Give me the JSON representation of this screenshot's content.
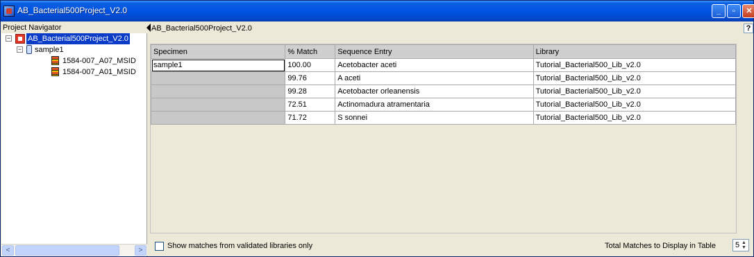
{
  "window": {
    "title": "AB_Bacterial500Project_V2.0",
    "buttons": [
      "minimize",
      "maximize",
      "close"
    ]
  },
  "navigator": {
    "title": "Project Navigator",
    "project": "AB_Bacterial500Project_V2.0",
    "sample": "sample1",
    "items": [
      "1584-007_A07_MSID",
      "1584-007_A01_MSID"
    ]
  },
  "main": {
    "title": "AB_Bacterial500Project_V2.0",
    "help": "?",
    "columns": [
      "Specimen",
      "% Match",
      "Sequence Entry",
      "Library"
    ],
    "rows": [
      {
        "specimen": "sample1",
        "match": "100.00",
        "entry": "Acetobacter aceti",
        "library": "Tutorial_Bacterial500_Lib_v2.0"
      },
      {
        "specimen": "",
        "match": "99.76",
        "entry": "A aceti",
        "library": "Tutorial_Bacterial500_Lib_v2.0"
      },
      {
        "specimen": "",
        "match": "99.28",
        "entry": "Acetobacter orleanensis",
        "library": "Tutorial_Bacterial500_Lib_v2.0"
      },
      {
        "specimen": "",
        "match": "72.51",
        "entry": "Actinomadura atramentaria",
        "library": "Tutorial_Bacterial500_Lib_v2.0"
      },
      {
        "specimen": "",
        "match": "71.72",
        "entry": "S sonnei",
        "library": "Tutorial_Bacterial500_Lib_v2.0"
      }
    ]
  },
  "footer": {
    "checkbox_label": "Show matches from validated libraries only",
    "checkbox_checked": false,
    "total_label": "Total Matches to Display in Table",
    "total_value": "5"
  },
  "colors": {
    "titlebar": "#0054e3",
    "selection": "#0a3cc8",
    "header_bg": "#cfcfcf",
    "empty_cell": "#c8c8c8"
  }
}
